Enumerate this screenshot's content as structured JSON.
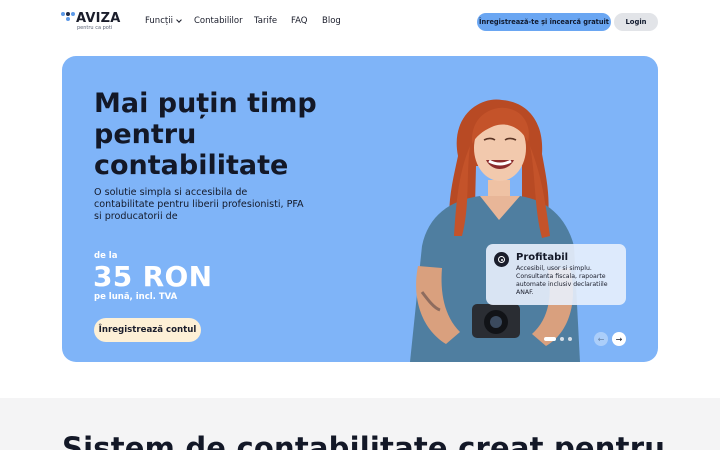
{
  "header": {
    "logo": {
      "name": "AVIZA",
      "tagline": "pentru ca poti"
    },
    "nav": [
      {
        "label": "Funcții",
        "has_dropdown": true
      },
      {
        "label": "Contabililor"
      },
      {
        "label": "Tarife"
      },
      {
        "label": "FAQ"
      },
      {
        "label": "Blog"
      }
    ],
    "trial_button": "Înregistrează-te și încearcă gratuit",
    "login_button": "Login"
  },
  "hero": {
    "title": "Mai puțin timp pentru contabilitate",
    "subtitle": "O solutie simpla si accesibila de contabilitate pentru liberii profesionisti, PFA si producatorii de",
    "price_from": "de la",
    "price_value": "35 RON",
    "price_note": "pe lună, incl. TVA",
    "cta_button": "Înregistrează contul",
    "feature_card": {
      "title": "Profitabil",
      "text": "Accesibil, usor si simplu. Consultanta fiscala, rapoarte automate inclusiv declaratiile ANAF."
    },
    "carousel": {
      "slides": 3,
      "active_index": 0
    }
  },
  "section": {
    "heading": "Sistem de contabilitate creat pentru"
  },
  "colors": {
    "hero_bg": "#7fb4f8",
    "accent": "#6aa6f2",
    "cta_bg": "#fdf0d6",
    "section_bg": "#f4f4f5"
  }
}
